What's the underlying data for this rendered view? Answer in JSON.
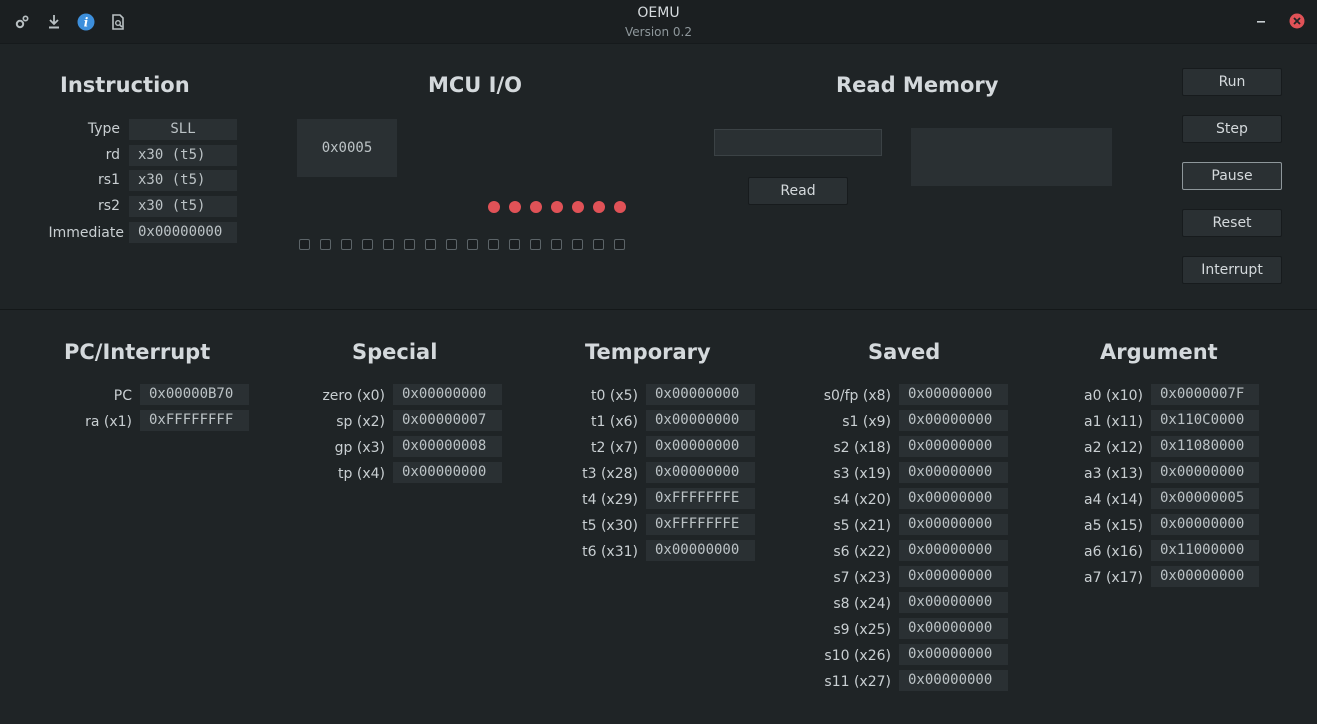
{
  "window": {
    "title": "OEMU",
    "subtitle": "Version 0.2",
    "icons": [
      "gears-icon",
      "download-icon",
      "info-icon",
      "document-search-icon"
    ],
    "controls": [
      "minimize-icon",
      "close-icon"
    ]
  },
  "instruction": {
    "heading": "Instruction",
    "rows": [
      {
        "label": "Type",
        "value": "SLL"
      },
      {
        "label": "rd",
        "value": "x30 (t5)"
      },
      {
        "label": "rs1",
        "value": "x30 (t5)"
      },
      {
        "label": "rs2",
        "value": "x30 (t5)"
      },
      {
        "label": "Immediate",
        "value": "0x00000000"
      }
    ]
  },
  "mcu_io": {
    "heading": "MCU I/O",
    "display": "0x0005",
    "led_count": 7,
    "switch_count": 16,
    "led_color": "#e05257"
  },
  "read_memory": {
    "heading": "Read Memory",
    "address": "",
    "result": "",
    "read_label": "Read"
  },
  "controls": {
    "run": "Run",
    "step": "Step",
    "pause": "Pause",
    "reset": "Reset",
    "interrupt": "Interrupt"
  },
  "registers": {
    "pc": {
      "heading": "PC/Interrupt",
      "rows": [
        {
          "label": "PC",
          "value": "0x00000B70"
        },
        {
          "label": "ra (x1)",
          "value": "0xFFFFFFFF"
        }
      ]
    },
    "special": {
      "heading": "Special",
      "rows": [
        {
          "label": "zero (x0)",
          "value": "0x00000000"
        },
        {
          "label": "sp (x2)",
          "value": "0x00000007"
        },
        {
          "label": "gp (x3)",
          "value": "0x00000008"
        },
        {
          "label": "tp (x4)",
          "value": "0x00000000"
        }
      ]
    },
    "temporary": {
      "heading": "Temporary",
      "rows": [
        {
          "label": "t0 (x5)",
          "value": "0x00000000"
        },
        {
          "label": "t1 (x6)",
          "value": "0x00000000"
        },
        {
          "label": "t2 (x7)",
          "value": "0x00000000"
        },
        {
          "label": "t3 (x28)",
          "value": "0x00000000"
        },
        {
          "label": "t4 (x29)",
          "value": "0xFFFFFFFE"
        },
        {
          "label": "t5 (x30)",
          "value": "0xFFFFFFFE"
        },
        {
          "label": "t6 (x31)",
          "value": "0x00000000"
        }
      ]
    },
    "saved": {
      "heading": "Saved",
      "rows": [
        {
          "label": "s0/fp (x8)",
          "value": "0x00000000"
        },
        {
          "label": "s1 (x9)",
          "value": "0x00000000"
        },
        {
          "label": "s2 (x18)",
          "value": "0x00000000"
        },
        {
          "label": "s3 (x19)",
          "value": "0x00000000"
        },
        {
          "label": "s4 (x20)",
          "value": "0x00000000"
        },
        {
          "label": "s5 (x21)",
          "value": "0x00000000"
        },
        {
          "label": "s6 (x22)",
          "value": "0x00000000"
        },
        {
          "label": "s7 (x23)",
          "value": "0x00000000"
        },
        {
          "label": "s8 (x24)",
          "value": "0x00000000"
        },
        {
          "label": "s9 (x25)",
          "value": "0x00000000"
        },
        {
          "label": "s10 (x26)",
          "value": "0x00000000"
        },
        {
          "label": "s11 (x27)",
          "value": "0x00000000"
        }
      ]
    },
    "argument": {
      "heading": "Argument",
      "rows": [
        {
          "label": "a0 (x10)",
          "value": "0x0000007F"
        },
        {
          "label": "a1 (x11)",
          "value": "0x110C0000"
        },
        {
          "label": "a2 (x12)",
          "value": "0x11080000"
        },
        {
          "label": "a3 (x13)",
          "value": "0x00000000"
        },
        {
          "label": "a4 (x14)",
          "value": "0x00000005"
        },
        {
          "label": "a5 (x15)",
          "value": "0x00000000"
        },
        {
          "label": "a6 (x16)",
          "value": "0x11000000"
        },
        {
          "label": "a7 (x17)",
          "value": "0x00000000"
        }
      ]
    }
  }
}
